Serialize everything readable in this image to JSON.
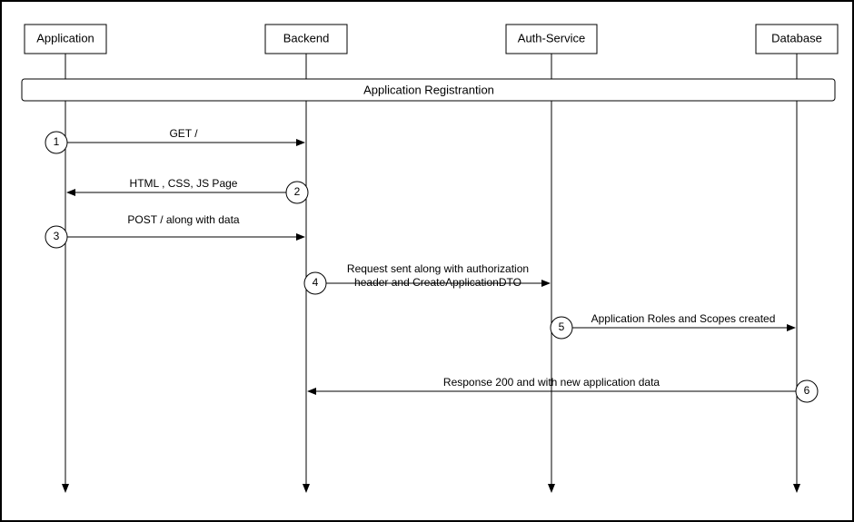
{
  "participants": {
    "p1": "Application",
    "p2": "Backend",
    "p3": "Auth-Service",
    "p4": "Database"
  },
  "banner": "Application Registrantion",
  "steps": {
    "s1": "1",
    "s2": "2",
    "s3": "3",
    "s4": "4",
    "s5": "5",
    "s6": "6"
  },
  "messages": {
    "m1": "GET /",
    "m2": "HTML , CSS, JS Page",
    "m3": "POST / along with data",
    "m4a": "Request sent along with authorization",
    "m4b": "header and CreateApplicationDTO",
    "m5": "Application Roles and Scopes created",
    "m6": "Response 200 and with new application data"
  }
}
